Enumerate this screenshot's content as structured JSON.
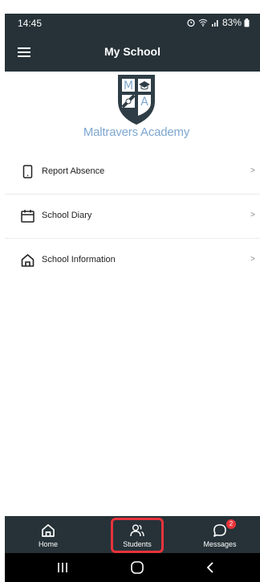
{
  "status_bar": {
    "time": "14:45",
    "battery": "83%"
  },
  "app_bar": {
    "title": "My School"
  },
  "logo": {
    "top_left": "M",
    "bottom_right": "A",
    "caption": "Maltravers Academy"
  },
  "menu": [
    {
      "label": "Report Absence",
      "chevron": ">"
    },
    {
      "label": "School Diary",
      "chevron": ">"
    },
    {
      "label": "School Information",
      "chevron": ">"
    }
  ],
  "bottom_nav": [
    {
      "label": "Home"
    },
    {
      "label": "Students"
    },
    {
      "label": "Messages",
      "badge": "2"
    }
  ],
  "colors": {
    "bar": "#263238",
    "highlight": "#e8333b",
    "logo_text": "#7ea7cf"
  }
}
